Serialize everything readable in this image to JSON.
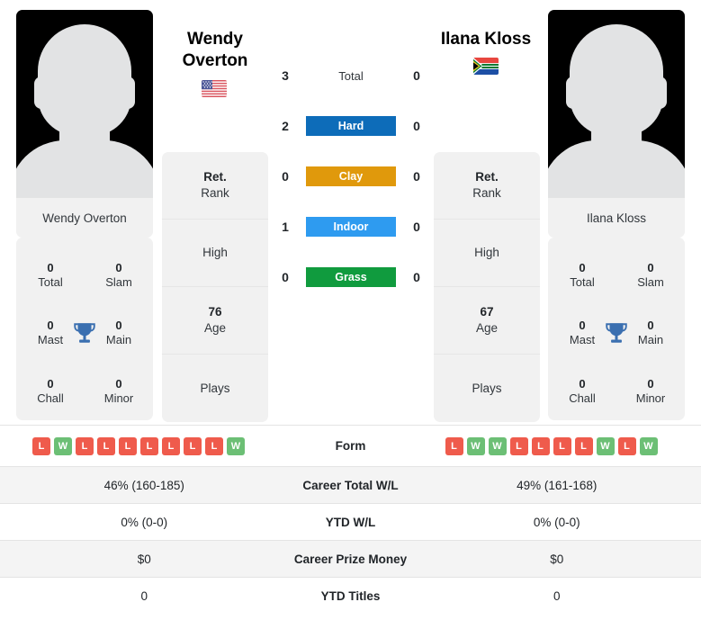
{
  "players": {
    "left": {
      "name": "Wendy Overton",
      "name_line1": "Wendy",
      "name_line2": "Overton",
      "flag": "us-flag-icon",
      "card_name": "Wendy Overton",
      "titles": [
        {
          "num": "0",
          "label": "Total"
        },
        {
          "num": "0",
          "label": "Slam"
        },
        {
          "num": "0",
          "label": "Mast"
        },
        {
          "num": "0",
          "label": "Main"
        },
        {
          "num": "0",
          "label": "Chall"
        },
        {
          "num": "0",
          "label": "Minor"
        }
      ],
      "info": [
        {
          "value": "Ret.",
          "label": "Rank"
        },
        {
          "value": "",
          "label": "High"
        },
        {
          "value": "76",
          "label": "Age"
        },
        {
          "value": "",
          "label": "Plays"
        }
      ],
      "form": [
        "L",
        "W",
        "L",
        "L",
        "L",
        "L",
        "L",
        "L",
        "L",
        "W"
      ],
      "career_total_wl": "46% (160-185)",
      "ytd_wl": "0% (0-0)",
      "career_prize_money": "$0",
      "ytd_titles": "0"
    },
    "right": {
      "name": "Ilana Kloss",
      "name_line1": "Ilana Kloss",
      "name_line2": "",
      "flag": "za-flag-icon",
      "card_name": "Ilana Kloss",
      "titles": [
        {
          "num": "0",
          "label": "Total"
        },
        {
          "num": "0",
          "label": "Slam"
        },
        {
          "num": "0",
          "label": "Mast"
        },
        {
          "num": "0",
          "label": "Main"
        },
        {
          "num": "0",
          "label": "Chall"
        },
        {
          "num": "0",
          "label": "Minor"
        }
      ],
      "info": [
        {
          "value": "Ret.",
          "label": "Rank"
        },
        {
          "value": "",
          "label": "High"
        },
        {
          "value": "67",
          "label": "Age"
        },
        {
          "value": "",
          "label": "Plays"
        }
      ],
      "form": [
        "L",
        "W",
        "W",
        "L",
        "L",
        "L",
        "L",
        "W",
        "L",
        "W"
      ],
      "career_total_wl": "49% (161-168)",
      "ytd_wl": "0% (0-0)",
      "career_prize_money": "$0",
      "ytd_titles": "0"
    }
  },
  "head_to_head": [
    {
      "label": "Total",
      "left": "3",
      "right": "0",
      "color": "",
      "text_color": "#31363b"
    },
    {
      "label": "Hard",
      "left": "2",
      "right": "0",
      "color": "#0d6cb9",
      "text_color": "#ffffff"
    },
    {
      "label": "Clay",
      "left": "0",
      "right": "0",
      "color": "#e0990c",
      "text_color": "#ffffff"
    },
    {
      "label": "Indoor",
      "left": "1",
      "right": "0",
      "color": "#2e9bf0",
      "text_color": "#ffffff"
    },
    {
      "label": "Grass",
      "left": "0",
      "right": "0",
      "color": "#109b3e",
      "text_color": "#ffffff"
    }
  ],
  "table_rows": [
    {
      "label": "Form",
      "left": "",
      "right": "",
      "type": "form",
      "shaded": false
    },
    {
      "label": "Career Total W/L",
      "left": "46% (160-185)",
      "right": "49% (161-168)",
      "type": "text",
      "shaded": true
    },
    {
      "label": "YTD W/L",
      "left": "0% (0-0)",
      "right": "0% (0-0)",
      "type": "text",
      "shaded": false
    },
    {
      "label": "Career Prize Money",
      "left": "$0",
      "right": "$0",
      "type": "text",
      "shaded": true
    },
    {
      "label": "YTD Titles",
      "left": "0",
      "right": "0",
      "type": "text",
      "shaded": false
    }
  ],
  "colors": {
    "win": "#6cbf75",
    "loss": "#ef5b4c",
    "hard": "#0d6cb9",
    "clay": "#e0990c",
    "indoor": "#2e9bf0",
    "grass": "#109b3e",
    "card_bg": "#f1f1f1",
    "trophy": "#3a6fb0"
  }
}
